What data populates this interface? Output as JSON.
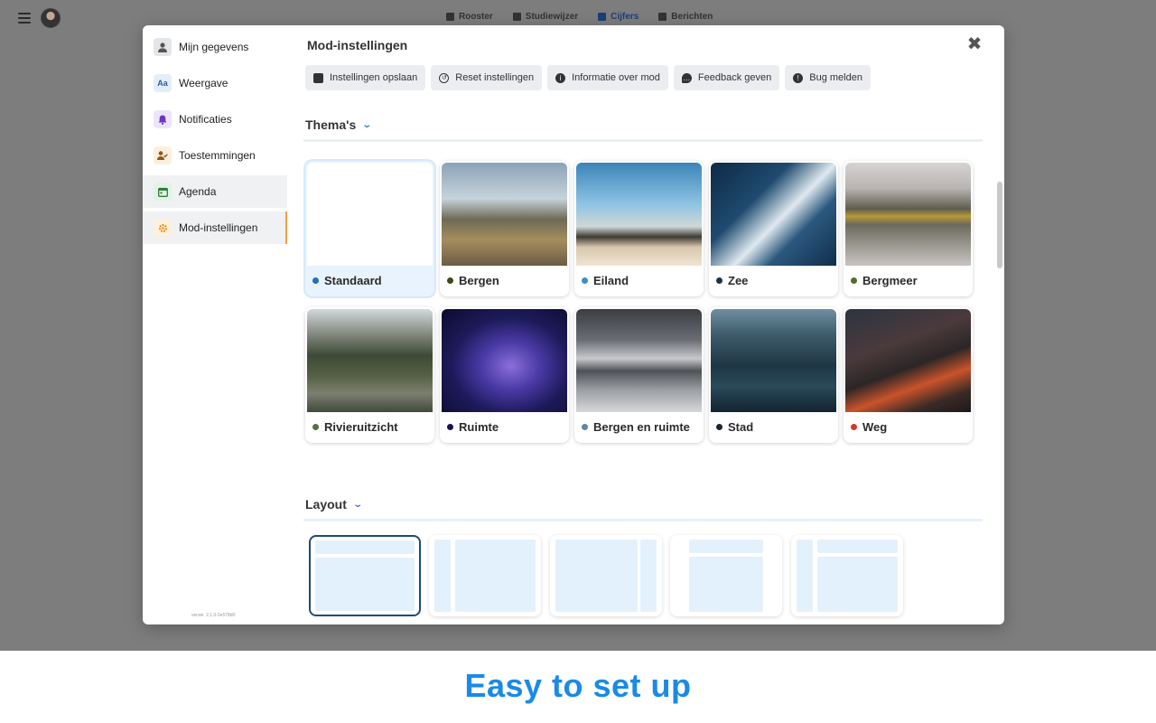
{
  "background_app": {
    "nav": [
      {
        "label": "Rooster",
        "icon": "calendar-grid-icon",
        "active": false
      },
      {
        "label": "Studiewijzer",
        "icon": "book-icon",
        "active": false
      },
      {
        "label": "Cijfers",
        "icon": "grades-icon",
        "active": true
      },
      {
        "label": "Berichten",
        "icon": "envelope-icon",
        "active": false
      }
    ]
  },
  "modal": {
    "title": "Mod-instellingen",
    "sidebar": {
      "items": [
        {
          "label": "Mijn gegevens",
          "icon": "user-icon"
        },
        {
          "label": "Weergave",
          "icon": "text-size-icon",
          "glyph": "Aa"
        },
        {
          "label": "Notificaties",
          "icon": "bell-icon"
        },
        {
          "label": "Toestemmingen",
          "icon": "user-check-icon"
        },
        {
          "label": "Agenda",
          "icon": "calendar-icon"
        },
        {
          "label": "Mod-instellingen",
          "icon": "gear-icon",
          "active": true
        }
      ],
      "version": "versie: 2.1.0-2e578d0"
    },
    "toolbar": [
      {
        "label": "Instellingen opslaan",
        "icon": "save-icon"
      },
      {
        "label": "Reset instellingen",
        "icon": "undo-icon"
      },
      {
        "label": "Informatie over mod",
        "icon": "info-icon"
      },
      {
        "label": "Feedback geven",
        "icon": "comment-icon"
      },
      {
        "label": "Bug melden",
        "icon": "alert-icon"
      }
    ],
    "themes_section": {
      "title": "Thema's"
    },
    "themes": [
      {
        "label": "Standaard",
        "dot": "#1f6fb8",
        "selected": true
      },
      {
        "label": "Bergen",
        "dot": "#3c4a1c"
      },
      {
        "label": "Eiland",
        "dot": "#3a8fc6"
      },
      {
        "label": "Zee",
        "dot": "#1c3248"
      },
      {
        "label": "Bergmeer",
        "dot": "#4f6e2a"
      },
      {
        "label": "Rivieruitzicht",
        "dot": "#5a6f45"
      },
      {
        "label": "Ruimte",
        "dot": "#1a1250"
      },
      {
        "label": "Bergen en ruimte",
        "dot": "#5c88a6"
      },
      {
        "label": "Stad",
        "dot": "#1b2633"
      },
      {
        "label": "Weg",
        "dot": "#d5372b"
      }
    ],
    "layout_section": {
      "title": "Layout"
    }
  },
  "tagline": "Easy to set up",
  "colors": {
    "accent_orange": "#f0a03a",
    "tagline_blue": "#1a8ae6",
    "selected_border": "#1f4b78"
  }
}
